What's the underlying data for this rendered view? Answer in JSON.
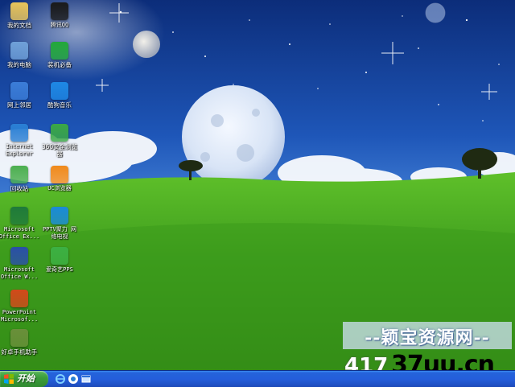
{
  "desktop": {
    "icons": [
      {
        "label": "我的文档",
        "icon": "folder-documents-icon",
        "color": "#e8c45a"
      },
      {
        "label": "腾讯QQ",
        "icon": "qq-penguin-icon",
        "color": "#1a1a1a"
      },
      {
        "label": "我的电脑",
        "icon": "computer-icon",
        "color": "#6fa0d8"
      },
      {
        "label": "装机必备",
        "icon": "shopping-bag-icon",
        "color": "#22a83a"
      },
      {
        "label": "网上邻居",
        "icon": "network-icon",
        "color": "#3b7dd8"
      },
      {
        "label": "酷狗音乐",
        "icon": "kugou-music-icon",
        "color": "#1e88e5"
      },
      {
        "label": "Internet\nExplorer",
        "icon": "ie-browser-icon",
        "color": "#2a7fd4"
      },
      {
        "label": "360安全浏览\n器",
        "icon": "360-browser-icon",
        "color": "#3aa845"
      },
      {
        "label": "回收站",
        "icon": "recycle-bin-icon",
        "color": "#4caf50"
      },
      {
        "label": "UC浏览器",
        "icon": "uc-browser-icon",
        "color": "#f08a1c"
      },
      {
        "label": "Microsoft\nOffice Ex...",
        "icon": "excel-icon",
        "color": "#1f7a3a"
      },
      {
        "label": "PPTV聚力 网\n络电视",
        "icon": "pptv-icon",
        "color": "#1a8ad8"
      },
      {
        "label": "Microsoft\nOffice W...",
        "icon": "word-icon",
        "color": "#2a4fa8"
      },
      {
        "label": "爱奇艺PPS",
        "icon": "iqiyi-icon",
        "color": "#3cb043"
      },
      {
        "label": "PowerPoint\nMicrosof...",
        "icon": "powerpoint-icon",
        "color": "#d2491a"
      },
      {
        "label": "好卓手机助手",
        "icon": "phone-assistant-icon",
        "color": "#6a8f3a"
      }
    ]
  },
  "taskbar": {
    "start_label": "开始",
    "quick_launch": [
      "ie-quicklaunch-icon",
      "qq-quicklaunch-icon",
      "show-desktop-icon"
    ]
  },
  "watermark": {
    "site_name": "--颖宝资源网--",
    "digits": "417",
    "domain": "37uu.cn"
  },
  "colors": {
    "taskbar": "#245edb",
    "start_button": "#3c9d3c",
    "sky": "#1d4fae",
    "grass": "#3f9e1e"
  }
}
